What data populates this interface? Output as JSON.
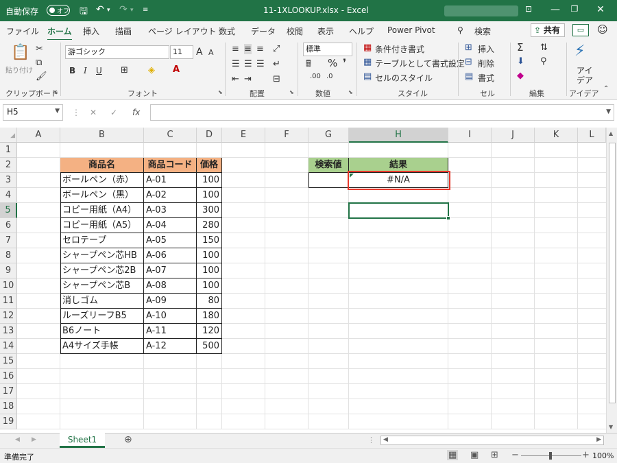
{
  "titlebar": {
    "autosave_label": "自動保存",
    "autosave_state": "オフ",
    "filename": "11-1XLOOKUP.xlsx",
    "separator": "-",
    "app": "Excel"
  },
  "ribbon_tabs": [
    "ファイル",
    "ホーム",
    "挿入",
    "描画",
    "ページ レイアウト",
    "数式",
    "データ",
    "校閲",
    "表示",
    "ヘルプ",
    "Power Pivot",
    "検索"
  ],
  "share_label": "共有",
  "ribbon": {
    "clipboard": {
      "paste": "貼り付け",
      "label": "クリップボード"
    },
    "font": {
      "name": "游ゴシック",
      "size": "11",
      "label": "フォント",
      "bold": "B",
      "italic": "I",
      "underline": "U",
      "grow": "A",
      "shrink": "A"
    },
    "alignment": {
      "label": "配置"
    },
    "number": {
      "format": "標準",
      "label": "数値"
    },
    "styles": {
      "conditional": "条件付き書式",
      "table": "テーブルとして書式設定",
      "cell": "セルのスタイル",
      "label": "スタイル"
    },
    "cells": {
      "insert": "挿入",
      "delete": "削除",
      "format": "書式",
      "label": "セル"
    },
    "editing": {
      "label": "編集"
    },
    "ideas": {
      "line1": "アイ",
      "line2": "デア",
      "label": "アイデア"
    }
  },
  "formula_bar": {
    "name_box": "H5",
    "formula": "",
    "fx": "fx"
  },
  "columns": [
    "A",
    "B",
    "C",
    "D",
    "E",
    "F",
    "G",
    "H",
    "I",
    "J",
    "K",
    "L"
  ],
  "rows": [
    "1",
    "2",
    "3",
    "4",
    "5",
    "6",
    "7",
    "8",
    "9",
    "10",
    "11",
    "12",
    "13",
    "14",
    "15",
    "16",
    "17",
    "18",
    "19"
  ],
  "table": {
    "headers": [
      "商品名",
      "商品コード",
      "価格"
    ],
    "rows": [
      [
        "ボールペン（赤）",
        "A-01",
        "100"
      ],
      [
        "ボールペン（黒）",
        "A-02",
        "100"
      ],
      [
        "コピー用紙（A4）",
        "A-03",
        "300"
      ],
      [
        "コピー用紙（A5）",
        "A-04",
        "280"
      ],
      [
        "セロテープ",
        "A-05",
        "150"
      ],
      [
        "シャープペン芯HB",
        "A-06",
        "100"
      ],
      [
        "シャープペン芯2B",
        "A-07",
        "100"
      ],
      [
        "シャープペン芯B",
        "A-08",
        "100"
      ],
      [
        "消しゴム",
        "A-09",
        "80"
      ],
      [
        "ルーズリーフB5",
        "A-10",
        "180"
      ],
      [
        "B6ノート",
        "A-11",
        "120"
      ],
      [
        "A4サイズ手帳",
        "A-12",
        "500"
      ]
    ]
  },
  "lookup": {
    "search_header": "検索値",
    "result_header": "結果",
    "search_value": "",
    "result_value": "#N/A"
  },
  "sheet_tab": "Sheet1",
  "status": {
    "ready": "準備完了",
    "zoom": "100%"
  },
  "colors": {
    "excel_green": "#217346",
    "orange_header": "#f4b183",
    "green_header": "#a9d08e",
    "highlight_red": "#e8382b"
  }
}
